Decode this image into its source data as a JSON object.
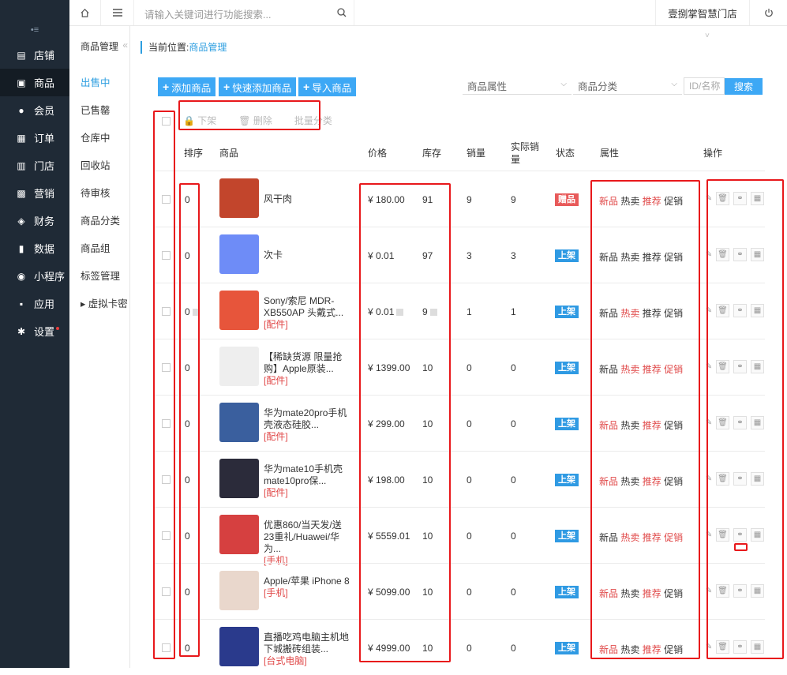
{
  "sidebar": {
    "items": [
      {
        "label": "店铺",
        "icon": "store-icon"
      },
      {
        "label": "商品",
        "icon": "goods-icon",
        "active": true
      },
      {
        "label": "会员",
        "icon": "user-icon"
      },
      {
        "label": "订单",
        "icon": "order-icon"
      },
      {
        "label": "门店",
        "icon": "shop-icon"
      },
      {
        "label": "营销",
        "icon": "gift-icon"
      },
      {
        "label": "财务",
        "icon": "money-icon"
      },
      {
        "label": "数据",
        "icon": "chart-icon"
      },
      {
        "label": "小程序",
        "icon": "miniprogram-icon"
      },
      {
        "label": "应用",
        "icon": "apps-icon"
      },
      {
        "label": "设置",
        "icon": "gear-icon"
      }
    ]
  },
  "submenu": {
    "title": "商品管理",
    "items": [
      "出售中",
      "已售罄",
      "仓库中",
      "回收站",
      "待审核",
      "商品分类",
      "商品组",
      "标签管理",
      "▸ 虚拟卡密"
    ]
  },
  "topbar": {
    "search_placeholder": "请输入关键词进行功能搜索...",
    "store": "壹捌掌智慧门店"
  },
  "breadcrumb": {
    "prefix": "当前位置:",
    "current": "商品管理"
  },
  "toolbar": {
    "add": "添加商品",
    "quick_add": "快速添加商品",
    "import": "导入商品",
    "attr_select": "商品属性",
    "cat_select": "商品分类",
    "id_placeholder": "ID/名称",
    "search": "搜索"
  },
  "bulk": {
    "offshelf": "下架",
    "delete": "删除",
    "batch_category": "批量分类"
  },
  "table": {
    "headers": {
      "sort": "排序",
      "product": "商品",
      "price": "价格",
      "stock": "库存",
      "sales": "销量",
      "real_sales_1": "实际销",
      "real_sales_2": "量",
      "status": "状态",
      "attrs": "属性",
      "ops": "操作"
    },
    "rows": [
      {
        "sort": "0",
        "name": "风干肉",
        "tag": "",
        "price": "¥ 180.00",
        "stock": "91",
        "sales": "9",
        "real": "9",
        "status": "赠品",
        "status_color": "#e85a5a",
        "attrs": [
          [
            "新品",
            1
          ],
          [
            "热卖",
            0
          ],
          [
            "推荐",
            1
          ],
          [
            "促销",
            0
          ]
        ],
        "thumb": "#c2452c"
      },
      {
        "sort": "0",
        "name": "次卡",
        "tag": "",
        "price": "¥ 0.01",
        "stock": "97",
        "sales": "3",
        "real": "3",
        "status": "上架",
        "status_color": "#2f9ae3",
        "attrs": [
          [
            "新品",
            0
          ],
          [
            "热卖",
            0
          ],
          [
            "推荐",
            0
          ],
          [
            "促销",
            0
          ]
        ],
        "thumb": "#6e8cf7"
      },
      {
        "sort": "0",
        "name": "Sony/索尼 MDR-XB550AP 头戴式...",
        "tag": "[配件]",
        "price": "¥ 0.01",
        "stock": "9",
        "sales": "1",
        "real": "1",
        "status": "上架",
        "status_color": "#2f9ae3",
        "attrs": [
          [
            "新品",
            0
          ],
          [
            "热卖",
            1
          ],
          [
            "推荐",
            0
          ],
          [
            "促销",
            0
          ]
        ],
        "thumb": "#e7553b"
      },
      {
        "sort": "0",
        "name": "【稀缺货源 限量抢购】Apple原装...",
        "tag": "[配件]",
        "price": "¥ 1399.00",
        "stock": "10",
        "sales": "0",
        "real": "0",
        "status": "上架",
        "status_color": "#2f9ae3",
        "attrs": [
          [
            "新品",
            0
          ],
          [
            "热卖",
            1
          ],
          [
            "推荐",
            1
          ],
          [
            "促销",
            1
          ]
        ],
        "thumb": "#eeeeee"
      },
      {
        "sort": "0",
        "name": "华为mate20pro手机壳液态硅胶...",
        "tag": "[配件]",
        "price": "¥ 299.00",
        "stock": "10",
        "sales": "0",
        "real": "0",
        "status": "上架",
        "status_color": "#2f9ae3",
        "attrs": [
          [
            "新品",
            1
          ],
          [
            "热卖",
            0
          ],
          [
            "推荐",
            1
          ],
          [
            "促销",
            0
          ]
        ],
        "thumb": "#3a5f9e"
      },
      {
        "sort": "0",
        "name": "华为mate10手机壳mate10pro保...",
        "tag": "[配件]",
        "price": "¥ 198.00",
        "stock": "10",
        "sales": "0",
        "real": "0",
        "status": "上架",
        "status_color": "#2f9ae3",
        "attrs": [
          [
            "新品",
            1
          ],
          [
            "热卖",
            0
          ],
          [
            "推荐",
            1
          ],
          [
            "促销",
            0
          ]
        ],
        "thumb": "#2b2b3a"
      },
      {
        "sort": "0",
        "name": "优惠860/当天发/送23重礼/Huawei/华为...",
        "tag": "[手机]",
        "price": "¥ 5559.01",
        "stock": "10",
        "sales": "0",
        "real": "0",
        "status": "上架",
        "status_color": "#2f9ae3",
        "attrs": [
          [
            "新品",
            0
          ],
          [
            "热卖",
            1
          ],
          [
            "推荐",
            1
          ],
          [
            "促销",
            1
          ]
        ],
        "thumb": "#d64040"
      },
      {
        "sort": "0",
        "name": "Apple/苹果 iPhone 8",
        "tag": "[手机]",
        "price": "¥ 5099.00",
        "stock": "10",
        "sales": "0",
        "real": "0",
        "status": "上架",
        "status_color": "#2f9ae3",
        "attrs": [
          [
            "新品",
            1
          ],
          [
            "热卖",
            0
          ],
          [
            "推荐",
            1
          ],
          [
            "促销",
            0
          ]
        ],
        "thumb": "#e9d7cc"
      },
      {
        "sort": "0",
        "name": "直播吃鸡电脑主机地下城搬砖组装...",
        "tag": "[台式电脑]",
        "price": "¥ 4999.00",
        "stock": "10",
        "sales": "0",
        "real": "0",
        "status": "上架",
        "status_color": "#2f9ae3",
        "attrs": [
          [
            "新品",
            1
          ],
          [
            "热卖",
            0
          ],
          [
            "推荐",
            1
          ],
          [
            "促销",
            0
          ]
        ],
        "thumb": "#2a3a8c"
      }
    ]
  }
}
